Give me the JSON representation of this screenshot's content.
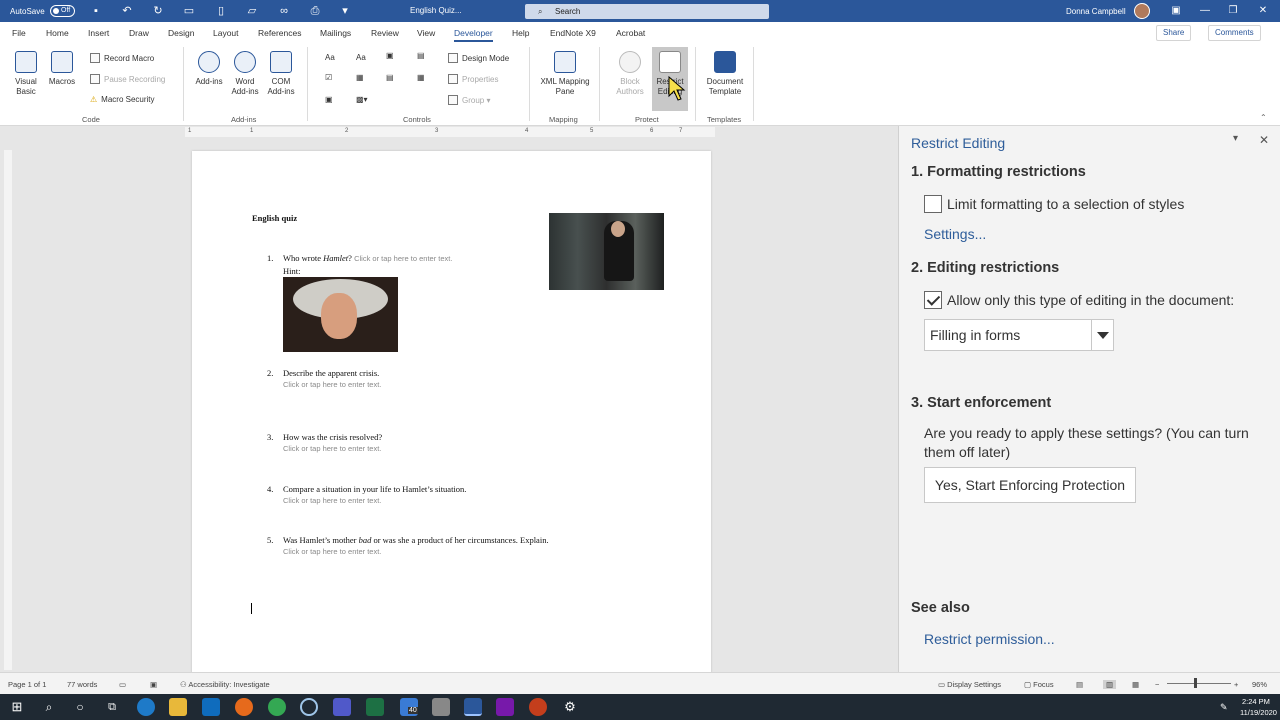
{
  "titlebar": {
    "autosave": "AutoSave",
    "toggle": "Off",
    "doc_title": "English Quiz...",
    "search_placeholder": "Search",
    "user": "Donna Campbell"
  },
  "tabs": [
    "File",
    "Home",
    "Insert",
    "Draw",
    "Design",
    "Layout",
    "References",
    "Mailings",
    "Review",
    "View",
    "Developer",
    "Help",
    "EndNote X9",
    "Acrobat"
  ],
  "share": "Share",
  "comments": "Comments",
  "ribbon": {
    "code": {
      "visual_basic": "Visual Basic",
      "macros": "Macros",
      "record": "Record Macro",
      "pause": "Pause Recording",
      "security": "Macro Security",
      "label": "Code"
    },
    "addins": {
      "addins": "Add-ins",
      "word": "Word Add-ins",
      "com": "COM Add-ins",
      "label": "Add-ins"
    },
    "controls": {
      "design_mode": "Design Mode",
      "properties": "Properties",
      "group": "Group",
      "label": "Controls"
    },
    "mapping": {
      "xml": "XML Mapping Pane",
      "label": "Mapping"
    },
    "protect": {
      "block": "Block Authors",
      "restrict": "Restrict Editing",
      "label": "Protect"
    },
    "templates": {
      "document": "Document Template",
      "label": "Templates"
    }
  },
  "ruler": [
    "1",
    "1",
    "2",
    "3",
    "4",
    "5",
    "6",
    "7"
  ],
  "doc": {
    "title": "English quiz",
    "placeholder": "Click or tap here to enter text.",
    "hint": "Hint:",
    "questions": [
      {
        "num": "1.",
        "pre": "Who wrote ",
        "em": "Hamlet",
        "post": "?"
      },
      {
        "num": "2.",
        "text": "Describe the apparent crisis."
      },
      {
        "num": "3.",
        "text": "How was the crisis resolved?"
      },
      {
        "num": "4.",
        "text": "Compare a situation in your life to Hamlet’s situation."
      },
      {
        "num": "5.",
        "pre": "Was Hamlet’s mother ",
        "em": "bad",
        "post": " or was she a product of her circumstances. Explain."
      }
    ]
  },
  "pane": {
    "title": "Restrict Editing",
    "s1": "1. Formatting restrictions",
    "limit": "Limit formatting to a selection of styles",
    "settings": "Settings...",
    "s2": "2. Editing restrictions",
    "allow": "Allow only this type of editing in the document:",
    "select": "Filling in forms",
    "s3": "3. Start enforcement",
    "ready1": "Are you ready to apply these settings? (You can turn",
    "ready2": "them off later)",
    "enforce_btn": "Yes, Start Enforcing Protection",
    "see_also": "See also",
    "permission": "Restrict permission..."
  },
  "status": {
    "page": "Page 1 of 1",
    "words": "77 words",
    "accessibility": "Accessibility: Investigate",
    "display": "Display Settings",
    "focus": "Focus",
    "zoom": "96%"
  },
  "taskbar": {
    "time": "2:24 PM",
    "date": "11/19/2020",
    "badge": "40"
  },
  "colors": {
    "brand": "#2b579a",
    "taskbar": "#1f2933"
  }
}
